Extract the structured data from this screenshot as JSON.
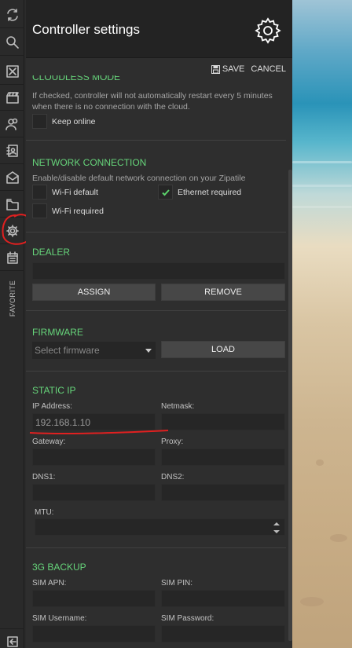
{
  "header": {
    "title": "Controller settings",
    "save_label": "SAVE",
    "cancel_label": "CANCEL"
  },
  "sidebar": {
    "favorite_label": "FAVORITE"
  },
  "cloudless": {
    "title": "CLOUDLESS MODE",
    "description": "If checked, controller will not automatically restart every 5 minutes when there is no connection with the cloud.",
    "keep_online_label": "Keep online",
    "keep_online_checked": false
  },
  "network": {
    "title": "NETWORK CONNECTION",
    "description": "Enable/disable default network connection on your Zipatile",
    "wifi_default_label": "Wi-Fi default",
    "wifi_default_checked": false,
    "ethernet_required_label": "Ethernet required",
    "ethernet_required_checked": true,
    "wifi_required_label": "Wi-Fi required",
    "wifi_required_checked": false
  },
  "dealer": {
    "title": "DEALER",
    "value": "",
    "assign_label": "ASSIGN",
    "remove_label": "REMOVE"
  },
  "firmware": {
    "title": "FIRMWARE",
    "select_placeholder": "Select firmware",
    "load_label": "LOAD"
  },
  "static_ip": {
    "title": "STATIC IP",
    "ip_label": "IP Address:",
    "ip_value": "192.168.1.10",
    "netmask_label": "Netmask:",
    "netmask_value": "",
    "gateway_label": "Gateway:",
    "gateway_value": "",
    "proxy_label": "Proxy:",
    "proxy_value": "",
    "dns1_label": "DNS1:",
    "dns1_value": "",
    "dns2_label": "DNS2:",
    "dns2_value": "",
    "mtu_label": "MTU:",
    "mtu_value": ""
  },
  "backup_3g": {
    "title": "3G BACKUP",
    "apn_label": "SIM APN:",
    "pin_label": "SIM PIN:",
    "username_label": "SIM Username:",
    "password_label": "SIM Password:"
  },
  "colors": {
    "accent_green": "#66d47a",
    "panel_bg": "#2e2e2e",
    "header_bg": "#232323",
    "annotation_red": "#e02020"
  }
}
